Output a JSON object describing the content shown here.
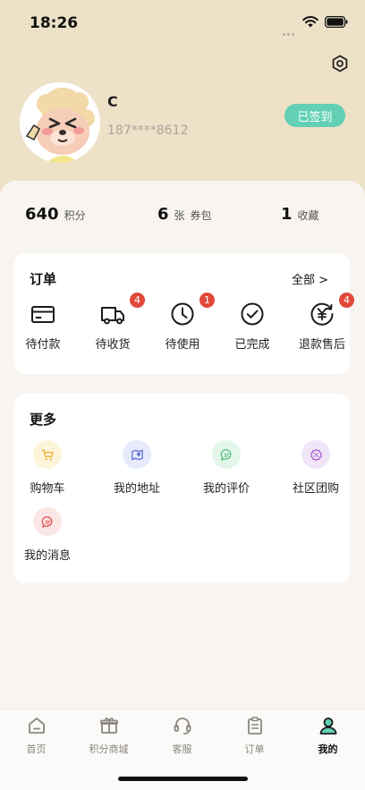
{
  "status_bar": {
    "time": "18:26"
  },
  "profile": {
    "name": "C",
    "phone": "187****8612",
    "checkin_label": "已签到"
  },
  "stats": [
    {
      "value": "640",
      "label": "积分"
    },
    {
      "value": "6",
      "unit": "张",
      "label": "券包"
    },
    {
      "value": "1",
      "label": "收藏"
    }
  ],
  "orders": {
    "title": "订单",
    "more_label": "全部 >",
    "items": [
      {
        "label": "待付款",
        "icon": "card-icon"
      },
      {
        "label": "待收货",
        "icon": "truck-icon",
        "badge": "4"
      },
      {
        "label": "待使用",
        "icon": "clock-icon",
        "badge": "1"
      },
      {
        "label": "已完成",
        "icon": "check-circle-icon"
      },
      {
        "label": "退款售后",
        "icon": "yen-refund-icon",
        "badge": "4"
      }
    ]
  },
  "more": {
    "title": "更多",
    "items": [
      {
        "label": "购物车",
        "icon": "cart-icon",
        "color": "#f2b43c"
      },
      {
        "label": "我的地址",
        "icon": "address-icon",
        "color": "#5f72d8"
      },
      {
        "label": "我的评价",
        "icon": "comment-icon",
        "color": "#4fc07c"
      },
      {
        "label": "社区团购",
        "icon": "group-buy-icon",
        "color": "#a35ac8"
      },
      {
        "label": "我的消息",
        "icon": "message-icon",
        "color": "#e05252"
      }
    ]
  },
  "tab_bar": {
    "tabs": [
      {
        "label": "首页",
        "icon": "home-icon"
      },
      {
        "label": "积分商城",
        "icon": "gift-icon"
      },
      {
        "label": "客服",
        "icon": "headset-icon"
      },
      {
        "label": "订单",
        "icon": "clipboard-icon"
      },
      {
        "label": "我的",
        "icon": "person-icon",
        "active": true
      }
    ]
  },
  "colors": {
    "header_bg": "#ede1c8",
    "accent": "#62d0b4",
    "badge": "#e0483a",
    "active_tab": "#2f8f83"
  }
}
